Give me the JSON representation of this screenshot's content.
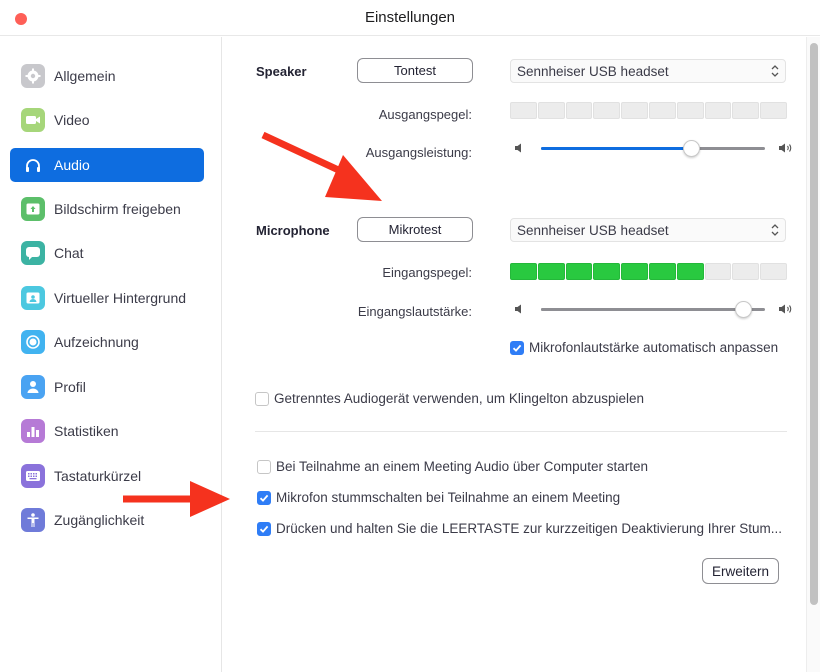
{
  "window": {
    "title": "Einstellungen"
  },
  "sidebar": {
    "items": [
      {
        "label": "Allgemein",
        "icon": "gear-icon",
        "color": "#c8c8cc",
        "active": false
      },
      {
        "label": "Video",
        "icon": "video-camera-icon",
        "color": "#a6d67a",
        "active": false
      },
      {
        "label": "Audio",
        "icon": "headphones-icon",
        "color": "#0e6de0",
        "active": true
      },
      {
        "label": "Bildschirm freigeben",
        "icon": "share-screen-icon",
        "color": "#5cbf6a",
        "active": false
      },
      {
        "label": "Chat",
        "icon": "chat-bubble-icon",
        "color": "#3cb3a3",
        "active": false
      },
      {
        "label": "Virtueller Hintergrund",
        "icon": "virtual-background-icon",
        "color": "#4cc8e0",
        "active": false
      },
      {
        "label": "Aufzeichnung",
        "icon": "record-icon",
        "color": "#41b3f0",
        "active": false
      },
      {
        "label": "Profil",
        "icon": "profile-icon",
        "color": "#4aa3f2",
        "active": false
      },
      {
        "label": "Statistiken",
        "icon": "statistics-icon",
        "color": "#b67ad6",
        "active": false
      },
      {
        "label": "Tastaturkürzel",
        "icon": "keyboard-icon",
        "color": "#8a72db",
        "active": false
      },
      {
        "label": "Zugänglichkeit",
        "icon": "accessibility-icon",
        "color": "#6f7bd9",
        "active": false
      }
    ]
  },
  "speaker": {
    "section_label": "Speaker",
    "test_button": "Tontest",
    "device": "Sennheiser USB headset",
    "output_level_label": "Ausgangspegel:",
    "output_level_segments_on": 0,
    "output_level_segments_total": 10,
    "output_volume_label": "Ausgangsleistung:",
    "output_volume_percent": 67
  },
  "microphone": {
    "section_label": "Microphone",
    "test_button": "Mikrotest",
    "device": "Sennheiser USB headset",
    "input_level_label": "Eingangspegel:",
    "input_level_segments_on": 7,
    "input_level_segments_total": 10,
    "input_volume_label": "Eingangslautstärke:",
    "input_volume_percent": 90,
    "auto_adjust": {
      "label": "Mikrofonlautstärke automatisch anpassen",
      "checked": true
    }
  },
  "options": [
    {
      "label": "Getrenntes Audiogerät verwenden, um Klingelton abzuspielen",
      "checked": false
    },
    {
      "label": "Bei Teilnahme an einem Meeting Audio über Computer starten",
      "checked": false
    },
    {
      "label": "Mikrofon stummschalten bei Teilnahme an einem Meeting",
      "checked": true
    },
    {
      "label": "Drücken und halten Sie die LEERTASTE zur kurzzeitigen Deaktivierung Ihrer Stum...",
      "checked": true
    }
  ],
  "advanced_button": "Erweitern",
  "colors": {
    "accent": "#0e6de0",
    "meter_on": "#29c940",
    "checkbox": "#2f7df6",
    "annotation_arrow": "#f5321e"
  }
}
